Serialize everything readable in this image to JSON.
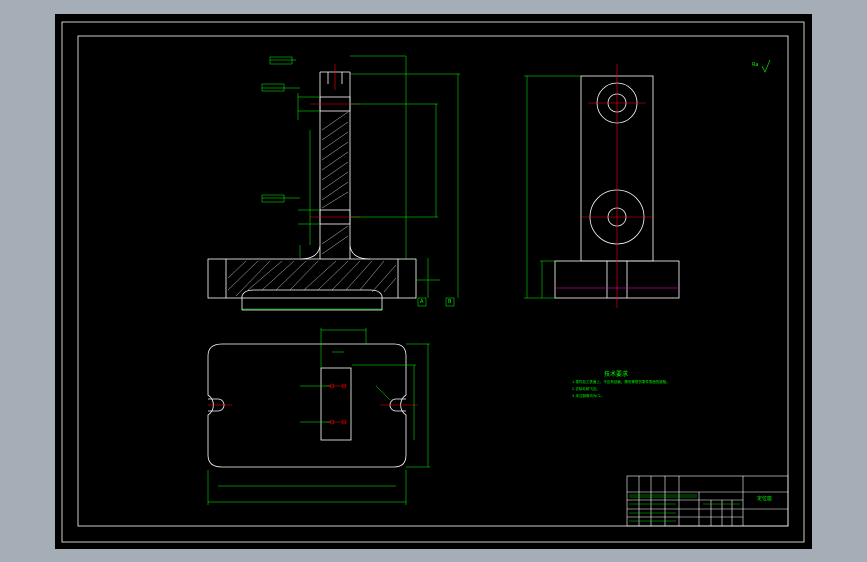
{
  "drawing": {
    "background_color": "#000000",
    "window_color": "#a5adb7",
    "line_color": "#ffffff",
    "dimension_color": "#00ff00",
    "centerline_color": "#ff0000",
    "phantom_color": "#ff00ff"
  },
  "roughness_symbol": "Ra",
  "datum_labels": [
    "A",
    "B"
  ],
  "technical_notes": {
    "title": "技术要求",
    "lines": [
      "1.零件加工表面上，不应有划痕、擦伤等损伤零件表面的缺陷。",
      "2.去除毛刺飞边。",
      "3.未注倒角均为C1。"
    ]
  },
  "title_block": {
    "part_name": "定位座"
  }
}
